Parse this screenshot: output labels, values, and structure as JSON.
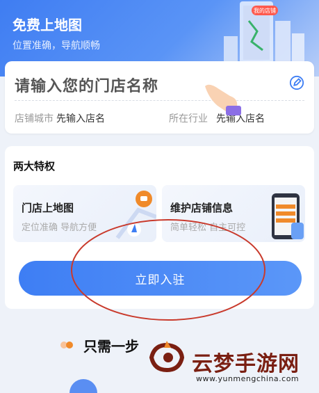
{
  "hero": {
    "title": "免费上地图",
    "subtitle": "位置准确，导航顺畅",
    "building_tag": "我的店铺"
  },
  "store_form": {
    "name_placeholder": "请输入您的门店名称",
    "city_label": "店铺城市",
    "city_value": "先输入店名",
    "industry_label": "所在行业",
    "industry_value": "先输入店名"
  },
  "privileges": {
    "title": "两大特权",
    "items": [
      {
        "title": "门店上地图",
        "subtitle": "定位准确 导航方便"
      },
      {
        "title": "维护店铺信息",
        "subtitle": "简单轻松 自主可控"
      }
    ],
    "cta_label": "立即入驻"
  },
  "steps": {
    "title": "只需一步"
  },
  "watermark": {
    "name": "云梦手游网",
    "url": "www.yunmengchina.com"
  },
  "colors": {
    "primary": "#3e7ef4",
    "annotation": "#c93a2c",
    "accent_orange": "#f08a2a"
  }
}
